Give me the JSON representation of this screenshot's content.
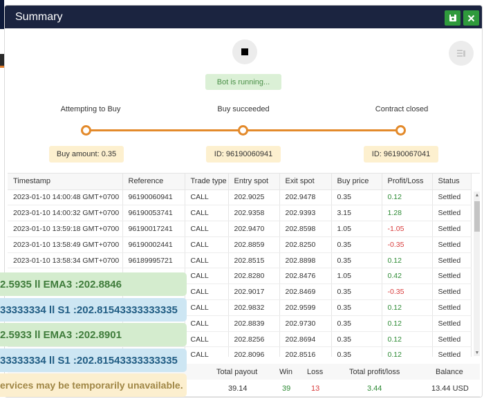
{
  "window": {
    "title": "Summary"
  },
  "controls": {
    "save_icon": "floppy-disk-icon",
    "close_icon": "close-x-icon",
    "stop_icon": "stop-square-icon",
    "clear_icon": "clear-list-icon"
  },
  "status": {
    "text": "Bot is running..."
  },
  "steps": [
    {
      "label": "Attempting to Buy",
      "info": "Buy amount: 0.35"
    },
    {
      "label": "Buy succeeded",
      "info": "ID: 96190060941"
    },
    {
      "label": "Contract closed",
      "info": "ID: 96190067041"
    }
  ],
  "table": {
    "headers": [
      "Timestamp",
      "Reference",
      "Trade type",
      "Entry spot",
      "Exit spot",
      "Buy price",
      "Profit/Loss",
      "Status"
    ],
    "rows": [
      [
        "2023-01-10 14:00:48 GMT+0700",
        "96190060941",
        "CALL",
        "202.9025",
        "202.9478",
        "0.35",
        "0.12",
        "Settled"
      ],
      [
        "2023-01-10 14:00:32 GMT+0700",
        "96190053741",
        "CALL",
        "202.9358",
        "202.9393",
        "3.15",
        "1.28",
        "Settled"
      ],
      [
        "2023-01-10 13:59:18 GMT+0700",
        "96190017241",
        "CALL",
        "202.9470",
        "202.8598",
        "1.05",
        "-1.05",
        "Settled"
      ],
      [
        "2023-01-10 13:58:49 GMT+0700",
        "96190002441",
        "CALL",
        "202.8859",
        "202.8250",
        "0.35",
        "-0.35",
        "Settled"
      ],
      [
        "2023-01-10 13:58:34 GMT+0700",
        "96189995721",
        "CALL",
        "202.8515",
        "202.8898",
        "0.35",
        "0.12",
        "Settled"
      ],
      [
        "",
        "",
        "CALL",
        "202.8280",
        "202.8476",
        "1.05",
        "0.42",
        "Settled"
      ],
      [
        "",
        "",
        "CALL",
        "202.9017",
        "202.8469",
        "0.35",
        "-0.35",
        "Settled"
      ],
      [
        "",
        "",
        "CALL",
        "202.9832",
        "202.9599",
        "0.35",
        "0.12",
        "Settled"
      ],
      [
        "",
        "",
        "CALL",
        "202.8839",
        "202.9730",
        "0.35",
        "0.12",
        "Settled"
      ],
      [
        "",
        "",
        "CALL",
        "202.8256",
        "202.8694",
        "0.35",
        "0.12",
        "Settled"
      ],
      [
        "",
        "",
        "CALL",
        "202.8096",
        "202.8516",
        "0.35",
        "0.12",
        "Settled"
      ]
    ]
  },
  "summary": {
    "headers": {
      "total_payout": "Total payout",
      "win": "Win",
      "loss": "Loss",
      "total_profit": "Total profit/loss",
      "balance": "Balance"
    },
    "values": {
      "total_payout": "39.14",
      "win": "39",
      "loss": "13",
      "total_profit": "3.44",
      "balance": "13.44 USD"
    }
  },
  "overlays": [
    {
      "text": "2.5935 ll EMA3 :202.8846",
      "style": "green"
    },
    {
      "text": "33333334 ll S1 :202.81543333333335",
      "style": "blue"
    },
    {
      "text": "2.5933 ll EMA3 :202.8901",
      "style": "green"
    },
    {
      "text": "33333334 ll S1 :202.81543333333335",
      "style": "blue"
    },
    {
      "text": "ervices may be temporarily unavailable.",
      "style": "yellow"
    }
  ],
  "colors": {
    "accent_orange": "#e38a2b",
    "profit_green": "#2d8a34",
    "loss_red": "#d83a3a",
    "titlebar": "#1b2440"
  }
}
